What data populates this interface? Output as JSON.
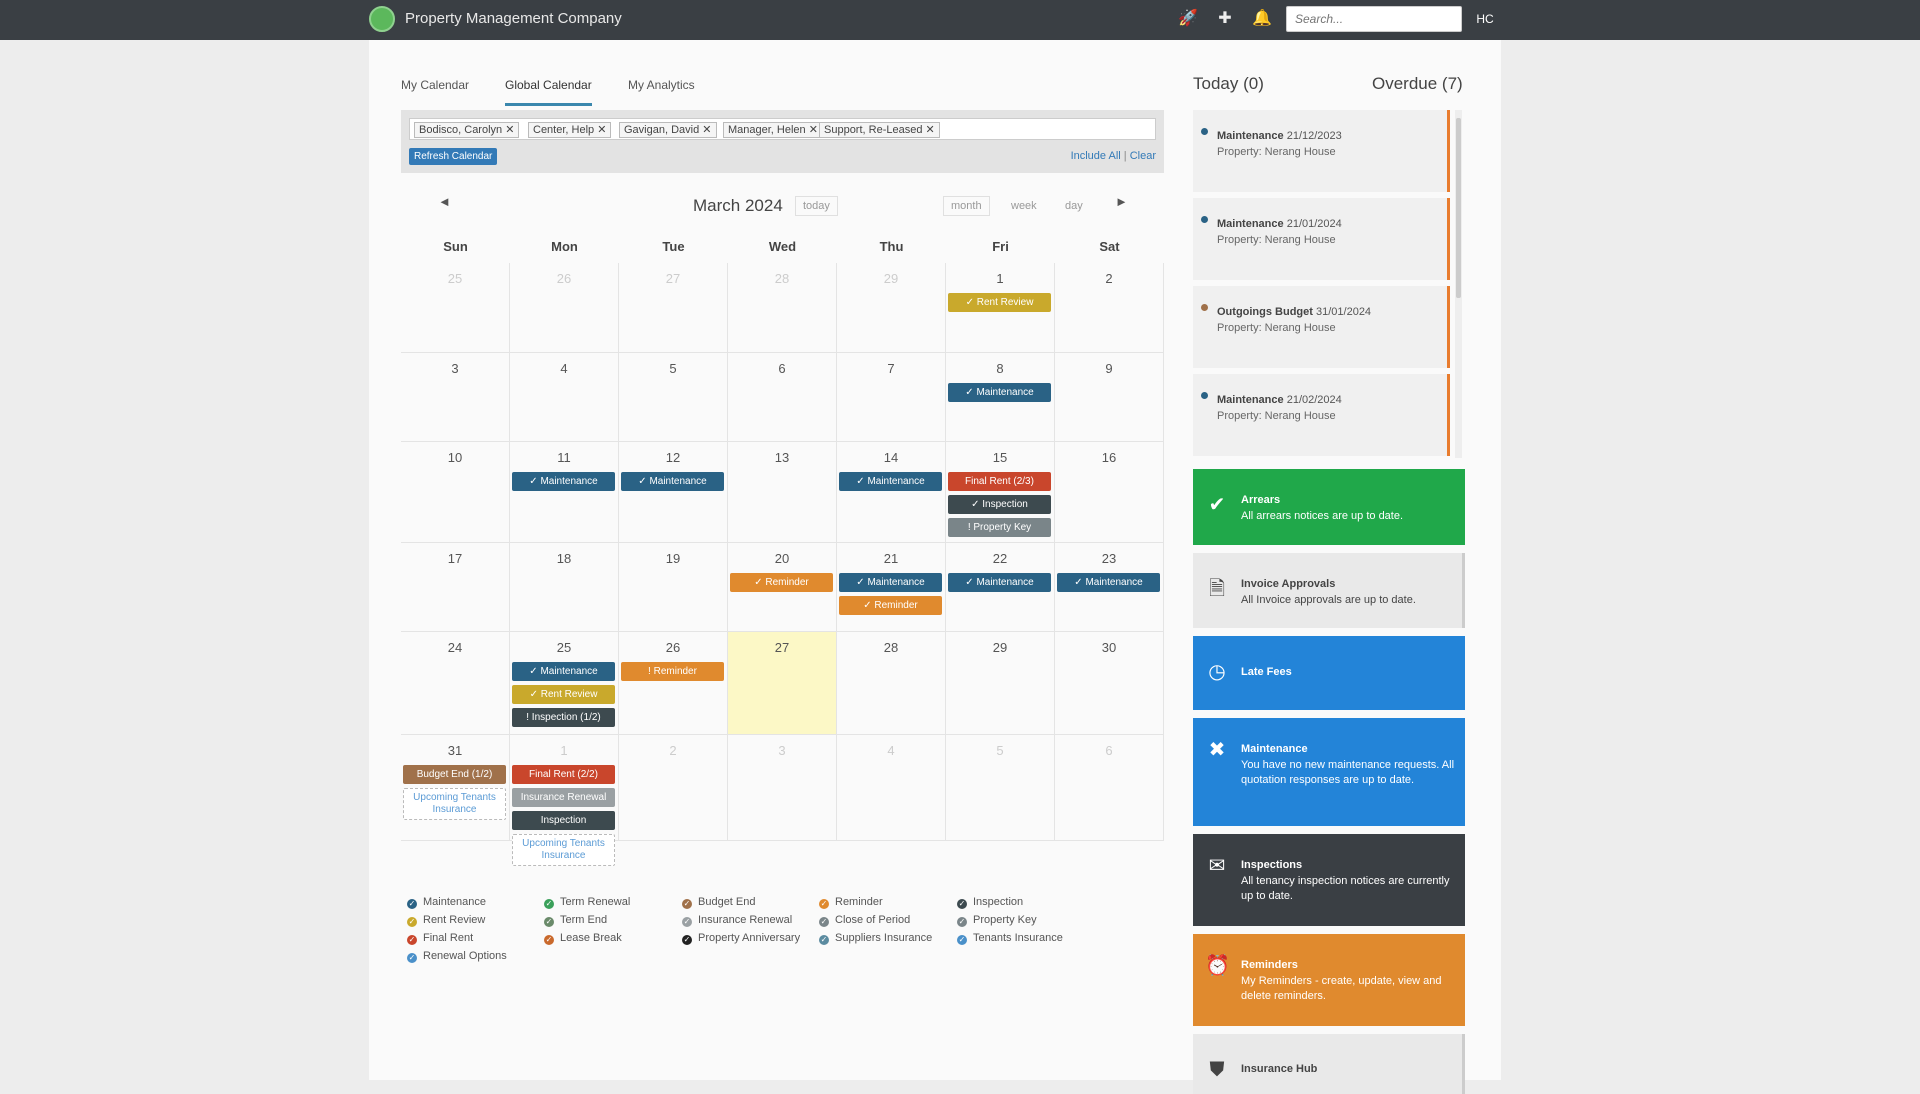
{
  "header": {
    "brand": "Property Management Company",
    "search_placeholder": "Search...",
    "avatar": "HC",
    "icons": [
      "rocket-icon",
      "plus-icon",
      "bell-icon"
    ]
  },
  "tabs": [
    "My Calendar",
    "Global Calendar",
    "My Analytics"
  ],
  "active_tab": "Global Calendar",
  "filter": {
    "tags": [
      "Bodisco, Carolyn",
      "Center, Help",
      "Gavigan, David",
      "Manager, Helen",
      "Support, Re-Leased"
    ],
    "refresh_label": "Refresh Calendar",
    "include_all": "Include All",
    "separator": "|",
    "clear": "Clear"
  },
  "calendar": {
    "title": "March 2024",
    "today_label": "today",
    "views": [
      "month",
      "week",
      "day"
    ],
    "prev": "◄",
    "next": "►",
    "days_of_week": [
      "Sun",
      "Mon",
      "Tue",
      "Wed",
      "Thu",
      "Fri",
      "Sat"
    ],
    "weeks": [
      [
        "25",
        "26",
        "27",
        "28",
        "29",
        "1",
        "2"
      ],
      [
        "3",
        "4",
        "5",
        "6",
        "7",
        "8",
        "9"
      ],
      [
        "10",
        "11",
        "12",
        "13",
        "14",
        "15",
        "16"
      ],
      [
        "17",
        "18",
        "19",
        "20",
        "21",
        "22",
        "23"
      ],
      [
        "24",
        "25",
        "26",
        "27",
        "28",
        "29",
        "30"
      ],
      [
        "31",
        "1",
        "2",
        "3",
        "4",
        "5",
        "6"
      ]
    ],
    "events": [
      {
        "week": 0,
        "day": 5,
        "slot": 0,
        "label": "✓ Rent Review",
        "color": "#c9a92c"
      },
      {
        "week": 1,
        "day": 5,
        "slot": 0,
        "label": "✓ Maintenance",
        "color": "#2a6285"
      },
      {
        "week": 2,
        "day": 1,
        "slot": 0,
        "label": "✓ Maintenance",
        "color": "#2a6285"
      },
      {
        "week": 2,
        "day": 2,
        "slot": 0,
        "label": "✓ Maintenance",
        "color": "#2a6285"
      },
      {
        "week": 2,
        "day": 4,
        "slot": 0,
        "label": "✓ Maintenance",
        "color": "#2a6285"
      },
      {
        "week": 2,
        "day": 5,
        "slot": 0,
        "label": "Final Rent (2/3)",
        "color": "#c9462c"
      },
      {
        "week": 2,
        "day": 5,
        "slot": 1,
        "label": "✓ Inspection",
        "color": "#3d4a4f"
      },
      {
        "week": 2,
        "day": 5,
        "slot": 2,
        "label": "! Property Key",
        "color": "#7a8589"
      },
      {
        "week": 3,
        "day": 3,
        "slot": 0,
        "label": "✓ Reminder",
        "color": "#e08a2e"
      },
      {
        "week": 3,
        "day": 4,
        "slot": 0,
        "label": "✓ Maintenance",
        "color": "#2a6285"
      },
      {
        "week": 3,
        "day": 4,
        "slot": 1,
        "label": "✓ Reminder",
        "color": "#e08a2e"
      },
      {
        "week": 3,
        "day": 5,
        "slot": 0,
        "label": "✓ Maintenance",
        "color": "#2a6285"
      },
      {
        "week": 3,
        "day": 6,
        "slot": 0,
        "label": "✓ Maintenance",
        "color": "#2a6285"
      },
      {
        "week": 4,
        "day": 1,
        "slot": 0,
        "label": "✓ Maintenance",
        "color": "#2a6285"
      },
      {
        "week": 4,
        "day": 1,
        "slot": 1,
        "label": "✓ Rent Review",
        "color": "#c9a92c"
      },
      {
        "week": 4,
        "day": 1,
        "slot": 2,
        "label": "! Inspection (1/2)",
        "color": "#3d4a4f"
      },
      {
        "week": 4,
        "day": 2,
        "slot": 0,
        "label": "! Reminder",
        "color": "#e08a2e"
      },
      {
        "week": 5,
        "day": 0,
        "slot": 0,
        "label": "Budget End (1/2)",
        "color": "#a0714a"
      },
      {
        "week": 5,
        "day": 0,
        "slot": 1,
        "label": "Upcoming Tenants Insurance",
        "dashed": true
      },
      {
        "week": 5,
        "day": 1,
        "slot": 0,
        "label": "Final Rent (2/2)",
        "color": "#c9462c"
      },
      {
        "week": 5,
        "day": 1,
        "slot": 1,
        "label": "Insurance Renewal",
        "color": "#9aa0a3"
      },
      {
        "week": 5,
        "day": 1,
        "slot": 2,
        "label": "Inspection",
        "color": "#3d4a4f"
      },
      {
        "week": 5,
        "day": 1,
        "slot": 3,
        "label": "Upcoming Tenants Insurance",
        "dashed": true
      }
    ]
  },
  "legend": [
    {
      "label": "Maintenance",
      "color": "#2a6285"
    },
    {
      "label": "Rent Review",
      "color": "#c9a92c"
    },
    {
      "label": "Final Rent",
      "color": "#c9462c"
    },
    {
      "label": "Renewal Options",
      "color": "#4a90c9"
    },
    {
      "label": "Term Renewal",
      "color": "#3aa05a"
    },
    {
      "label": "Term End",
      "color": "#6a8a6a"
    },
    {
      "label": "Lease Break",
      "color": "#c9692c"
    },
    {
      "label": "Budget End",
      "color": "#a0714a"
    },
    {
      "label": "Insurance Renewal",
      "color": "#9aa0a3"
    },
    {
      "label": "Property Anniversary",
      "color": "#222222"
    },
    {
      "label": "Reminder",
      "color": "#e08a2e"
    },
    {
      "label": "Close of Period",
      "color": "#7a8589"
    },
    {
      "label": "Suppliers Insurance",
      "color": "#5b8ba0"
    },
    {
      "label": "Inspection",
      "color": "#3d4a4f"
    },
    {
      "label": "Property Key",
      "color": "#7a8589"
    },
    {
      "label": "Tenants Insurance",
      "color": "#4a90c9"
    }
  ],
  "sidebar": {
    "today": "Today (0)",
    "overdue": "Overdue (7)",
    "notifications": [
      {
        "type": "Maintenance",
        "date": "21/12/2023",
        "property": "Property: Nerang House",
        "dot": "#2a6285"
      },
      {
        "type": "Maintenance",
        "date": "21/01/2024",
        "property": "Property: Nerang House",
        "dot": "#2a6285"
      },
      {
        "type": "Outgoings Budget",
        "date": "31/01/2024",
        "property": "Property: Nerang House",
        "dot": "#a0714a"
      },
      {
        "type": "Maintenance",
        "date": "21/02/2024",
        "property": "Property: Nerang House",
        "dot": "#2a6285"
      }
    ],
    "panels": [
      {
        "title": "Arrears",
        "text": "All arrears notices are up to date.",
        "color": "#20a84a",
        "icon": "check-circle-icon",
        "glyph": "✔"
      },
      {
        "title": "Invoice Approvals",
        "text": "All Invoice approvals are up to date.",
        "color": "#e9e9e9",
        "icon": "document-icon",
        "glyph": "🗎"
      },
      {
        "title": "Late Fees",
        "text": "",
        "color": "#2384d8",
        "icon": "clock-icon",
        "glyph": "◷"
      },
      {
        "title": "Maintenance",
        "text": "You have no new maintenance requests. All quotation responses are up to date.",
        "color": "#2384d8",
        "icon": "wrench-icon",
        "glyph": "✖"
      },
      {
        "title": "Inspections",
        "text": "All tenancy inspection notices are currently up to date.",
        "color": "#3a3f44",
        "icon": "envelope-icon",
        "glyph": "✉"
      },
      {
        "title": "Reminders",
        "text": "My Reminders - create, update, view and delete reminders.",
        "color": "#e08a2e",
        "icon": "alarm-clock-icon",
        "glyph": "⏰"
      },
      {
        "title": "Insurance Hub",
        "text": "",
        "color": "#e9e9e9",
        "icon": "shield-icon",
        "glyph": "⛊"
      }
    ]
  }
}
